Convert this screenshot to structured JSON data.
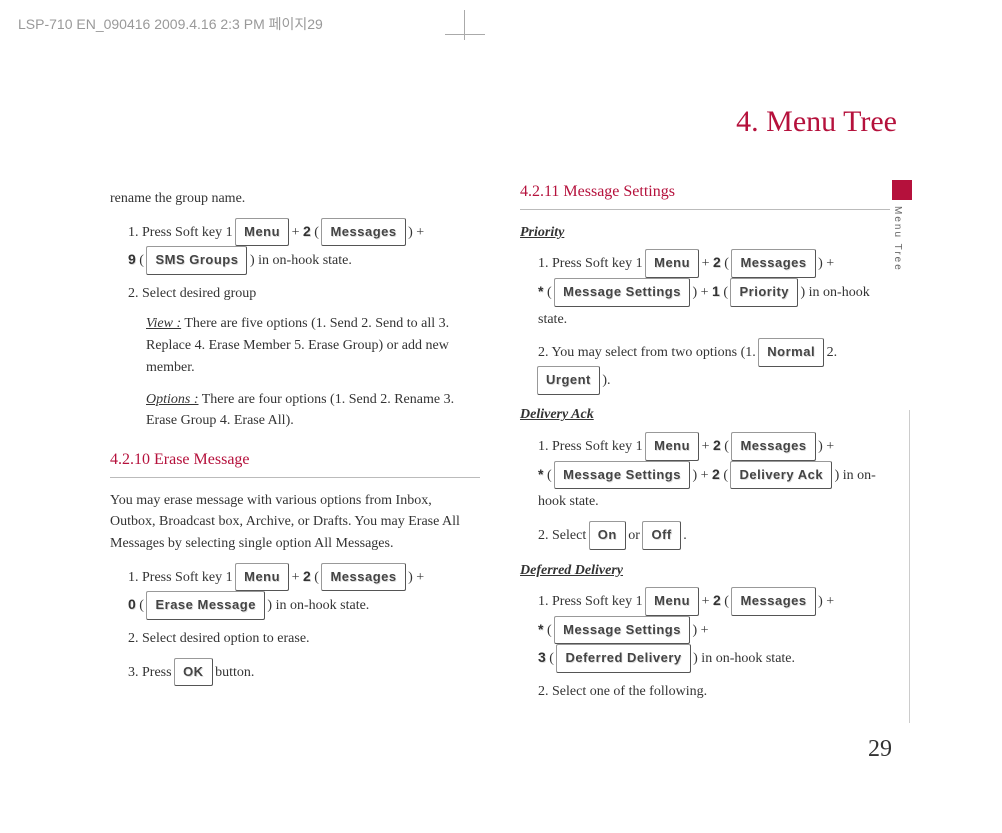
{
  "header_meta": "LSP-710 EN_090416  2009.4.16 2:3 PM  페이지29",
  "chapter_title": "4. Menu Tree",
  "side_label": "Menu Tree",
  "page_number": "29",
  "left": {
    "rename_line": "rename the group name.",
    "step1_a": "1. Press Soft key 1 ",
    "menu": "Menu",
    "key2": "2",
    "messages": "Messages",
    "key9": "9",
    "sms_groups": "SMS Groups",
    "step1_b": " ) in on-hook state.",
    "step2": "2.  Select desired group",
    "view_label": "View :",
    "view_text": " There are five options (1. Send 2. Send to all  3. Replace  4. Erase Member  5. Erase Group) or add new member.",
    "options_label": "Options :",
    "options_text": " There are four options (1. Send  2. Rename  3. Erase Group 4. Erase All).",
    "sec_erase": "4.2.10 Erase Message",
    "erase_para": "You may erase message with various options from Inbox, Outbox, Broadcast box, Archive, or Drafts. You may Erase All Messages by selecting single option All Messages.",
    "key0": "0",
    "erase_message": "Erase Message",
    "erase_step2": "2. Select desired option to erase.",
    "erase_step3_a": "3. Press ",
    "ok": "OK",
    "erase_step3_b": " button."
  },
  "right": {
    "sec_settings": "4.2.11 Message Settings",
    "priority_title": "Priority",
    "menu": "Menu",
    "key2": "2",
    "messages": "Messages",
    "star": "*",
    "message_settings": "Message Settings",
    "key1": "1",
    "priority": "Priority",
    "priority_end": " ) in on-hook state.",
    "priority_opt_a": "2. You may select from two options (1.  ",
    "normal": "Normal",
    "priority_opt_b": " 2. ",
    "urgent": "Urgent",
    "priority_opt_c": " ).",
    "delivery_ack_title": "Delivery Ack",
    "delivery_ack": "Delivery Ack",
    "da_end": " in on- hook state.",
    "da_step2_a": "2. Select  ",
    "on": "On",
    "da_step2_b": "  or  ",
    "off": "Off",
    "da_step2_c": " .",
    "deferred_title": "Deferred Delivery",
    "key3": "3",
    "deferred_delivery": "Deferred Delivery",
    "dd_end": " ) in on-hook state.",
    "dd_step2": "2. Select one of the following."
  }
}
